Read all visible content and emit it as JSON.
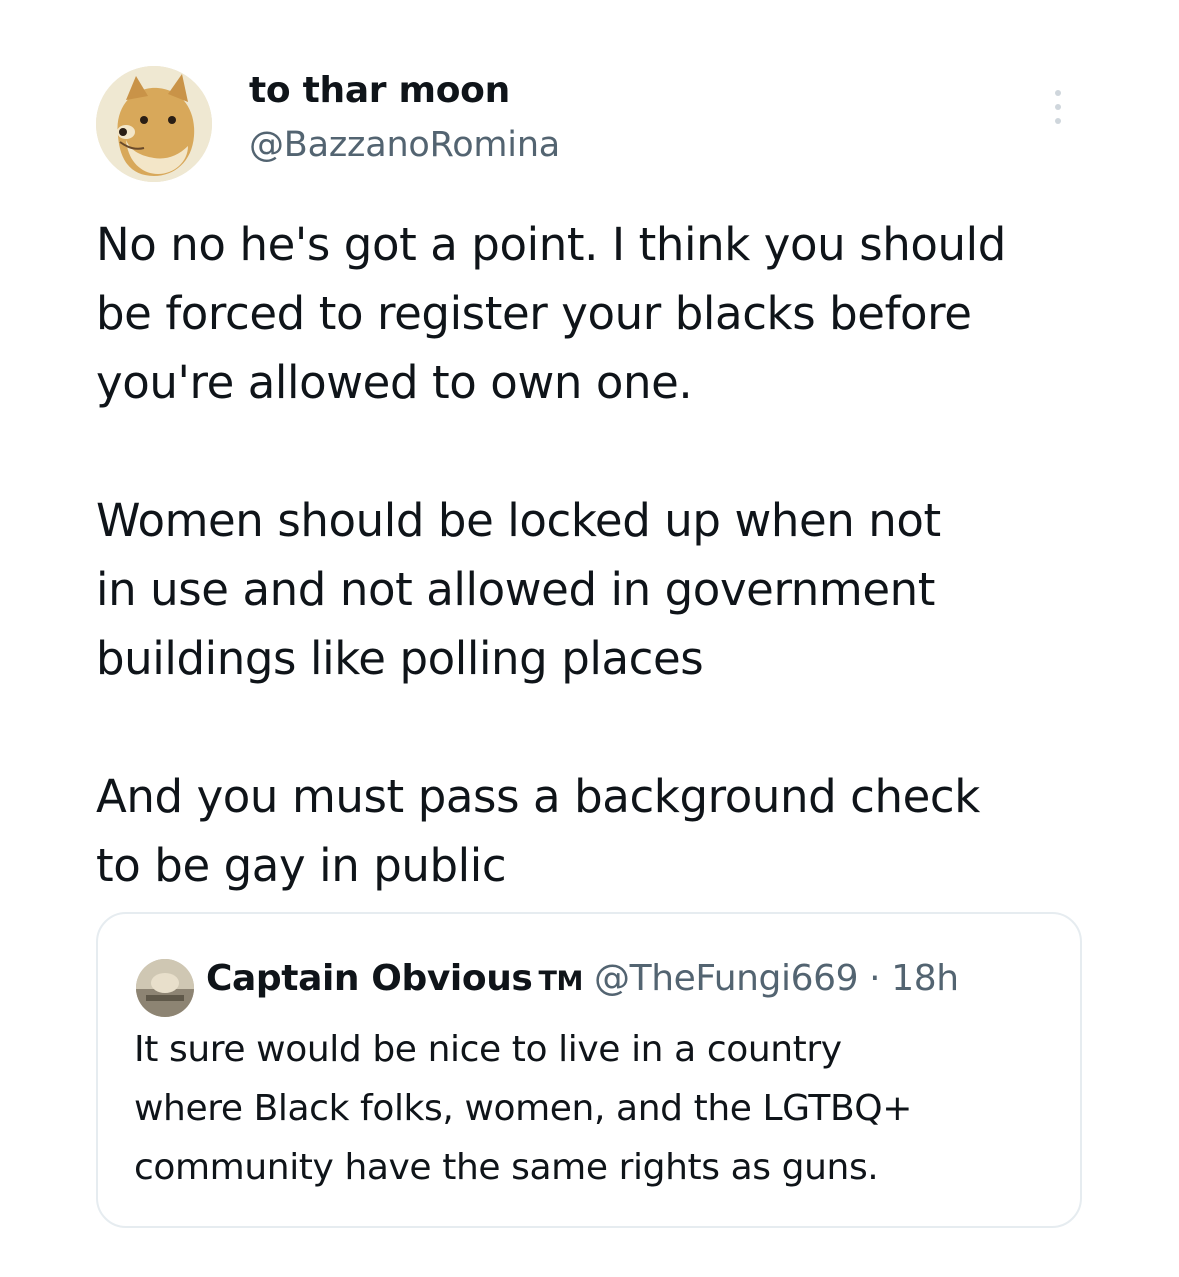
{
  "tweet": {
    "author_name": "to thar moon",
    "author_handle": "@BazzanoRomina",
    "avatar_icon": "doge-avatar",
    "more_icon": "more-vertical-icon",
    "paragraphs": [
      [
        "No no he's got a point. I think you should",
        "be forced to register your blacks before",
        "you're allowed to own one."
      ],
      [
        "Women should be locked up when not",
        "in use and not allowed in government",
        "buildings like polling places"
      ],
      [
        "And you must pass a background check",
        "to be gay in public"
      ]
    ]
  },
  "quote": {
    "author_name": "Captain Obvious",
    "author_suffix": "TM",
    "author_handle": "@TheFungi669",
    "separator": "·",
    "time": "18h",
    "lines": [
      "It sure would be nice to live in a country",
      "where Black folks, women, and the LGTBQ+",
      "community have the same rights as guns."
    ]
  },
  "colors": {
    "text": "#0f1419",
    "secondary": "#536471",
    "border": "#e6ecf0"
  }
}
